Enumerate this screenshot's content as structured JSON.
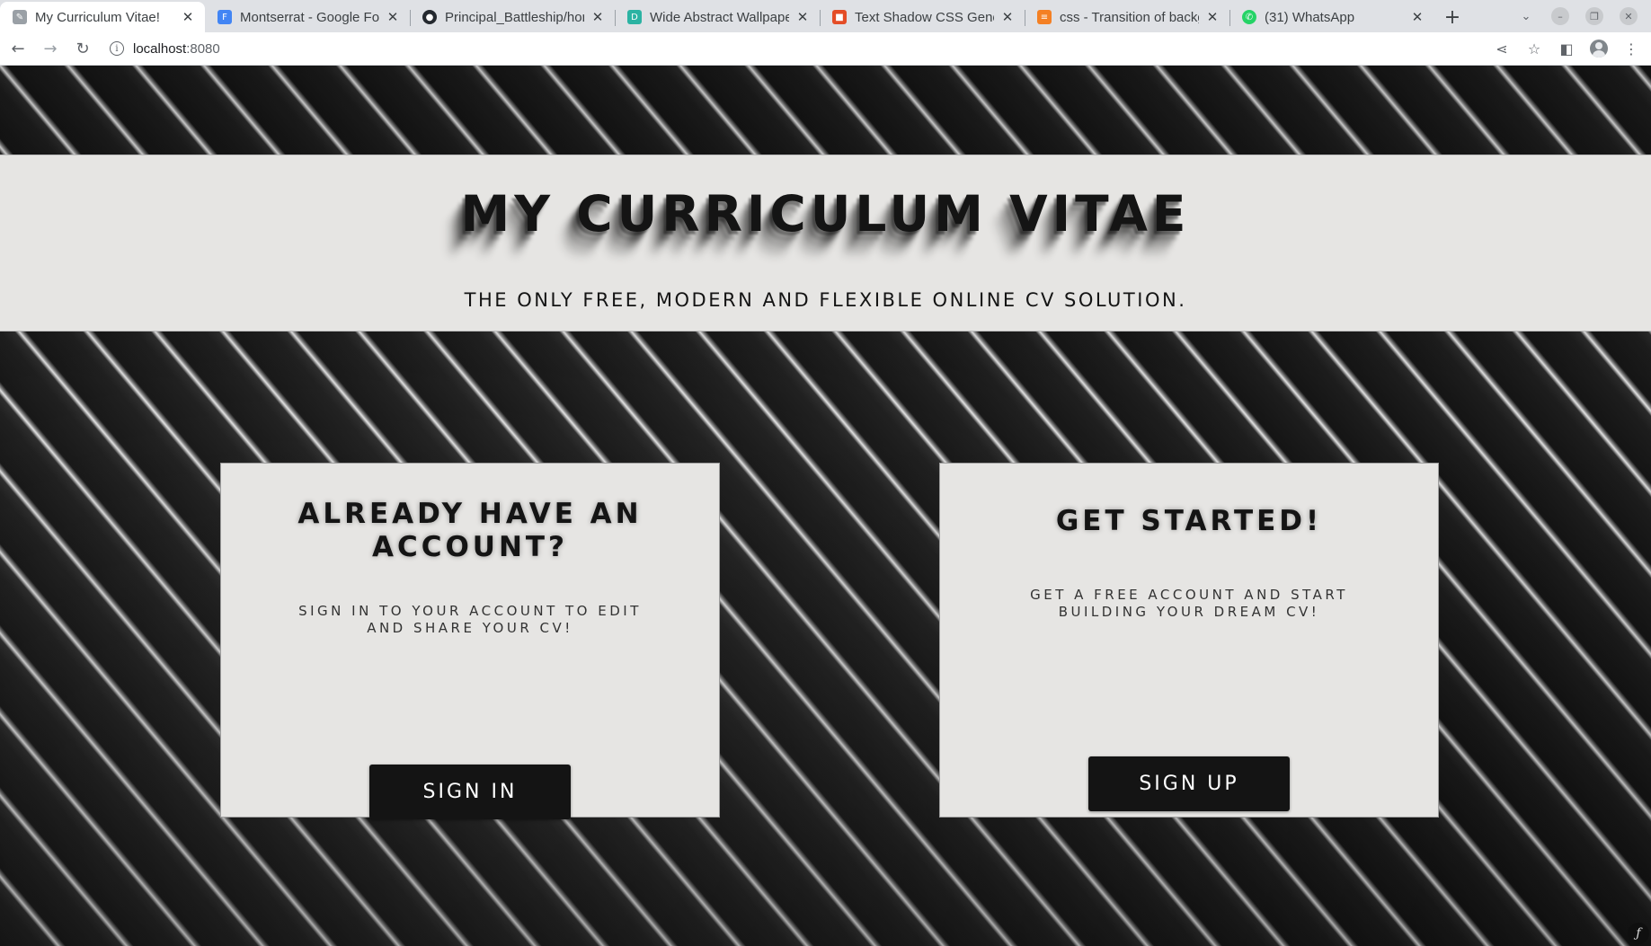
{
  "browser": {
    "tabs": [
      {
        "title": "My Curriculum Vitae!",
        "icon": "page-icon",
        "color": "#9aa0a6",
        "active": true
      },
      {
        "title": "Montserrat - Google Fonts",
        "icon": "google-fonts-icon",
        "color": "#4285f4",
        "active": false
      },
      {
        "title": "Principal_Battleship/home",
        "icon": "github-icon",
        "color": "#24292f",
        "active": false
      },
      {
        "title": "Wide Abstract Wallpapers",
        "icon": "wallpaper-site-icon",
        "color": "#2bb3a3",
        "active": false
      },
      {
        "title": "Text Shadow CSS Generator",
        "icon": "css-generator-icon",
        "color": "#e44d26",
        "active": false
      },
      {
        "title": "css - Transition of background",
        "icon": "stackoverflow-icon",
        "color": "#f48024",
        "active": false
      },
      {
        "title": "(31) WhatsApp",
        "icon": "whatsapp-icon",
        "color": "#25d366",
        "active": false
      }
    ],
    "address": {
      "host": "localhost",
      "port": ":8080"
    }
  },
  "hero": {
    "title": "MY CURRICULUM VITAE",
    "subtitle": "THE ONLY FREE, MODERN AND FLEXIBLE ONLINE CV SOLUTION."
  },
  "signin_card": {
    "title": "ALREADY HAVE AN ACCOUNT?",
    "text": "SIGN IN TO YOUR ACCOUNT TO EDIT AND SHARE YOUR CV!",
    "button": "SIGN IN"
  },
  "signup_card": {
    "title": "GET STARTED!",
    "text": "GET A FREE ACCOUNT AND START BUILDING YOUR DREAM CV!",
    "button": "SIGN UP"
  },
  "colors": {
    "panel": "#e6e5e3",
    "button": "#141414",
    "text": "#141414"
  }
}
